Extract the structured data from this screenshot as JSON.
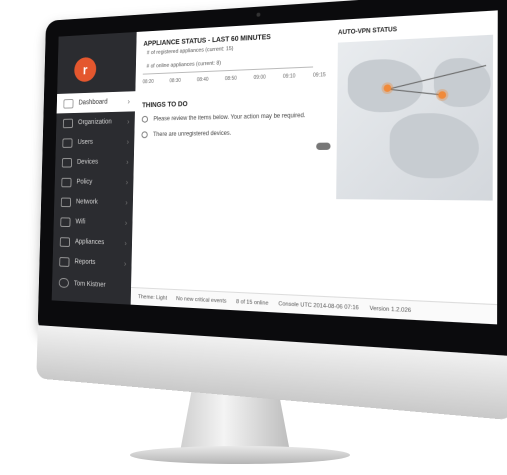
{
  "app": {
    "logo_letter": "r",
    "brand_color": "#e4572e"
  },
  "sidebar": {
    "items": [
      {
        "label": "Dashboard",
        "icon": "dashboard-icon",
        "active": true
      },
      {
        "label": "Organization",
        "icon": "home-icon"
      },
      {
        "label": "Users",
        "icon": "users-icon"
      },
      {
        "label": "Devices",
        "icon": "devices-icon"
      },
      {
        "label": "Policy",
        "icon": "policy-icon"
      },
      {
        "label": "Network",
        "icon": "network-icon"
      },
      {
        "label": "Wifi",
        "icon": "wifi-icon"
      },
      {
        "label": "Appliances",
        "icon": "appliances-icon"
      },
      {
        "label": "Reports",
        "icon": "reports-icon"
      }
    ],
    "user_name": "Tom Kistner"
  },
  "status": {
    "title": "APPLIANCE STATUS - LAST 60 MINUTES",
    "legend_registered": "# of registered appliances (current: 15)",
    "legend_online": "# of online appliances (current: 8)",
    "ticks": [
      "08:20",
      "08:30",
      "08:40",
      "08:50",
      "09:00",
      "09:10",
      "09:15"
    ]
  },
  "todo": {
    "title": "THINGS TO DO",
    "items": [
      "Please review the items below. Your action may be required.",
      "There are unregistered devices."
    ]
  },
  "map": {
    "title": "AUTO-VPN STATUS"
  },
  "footer": {
    "theme": "Theme: Light",
    "events": "No new critical events",
    "online": "8 of 15 online",
    "console": "Console UTC 2014-08-06 07:16",
    "version": "Version 1.2.026"
  }
}
